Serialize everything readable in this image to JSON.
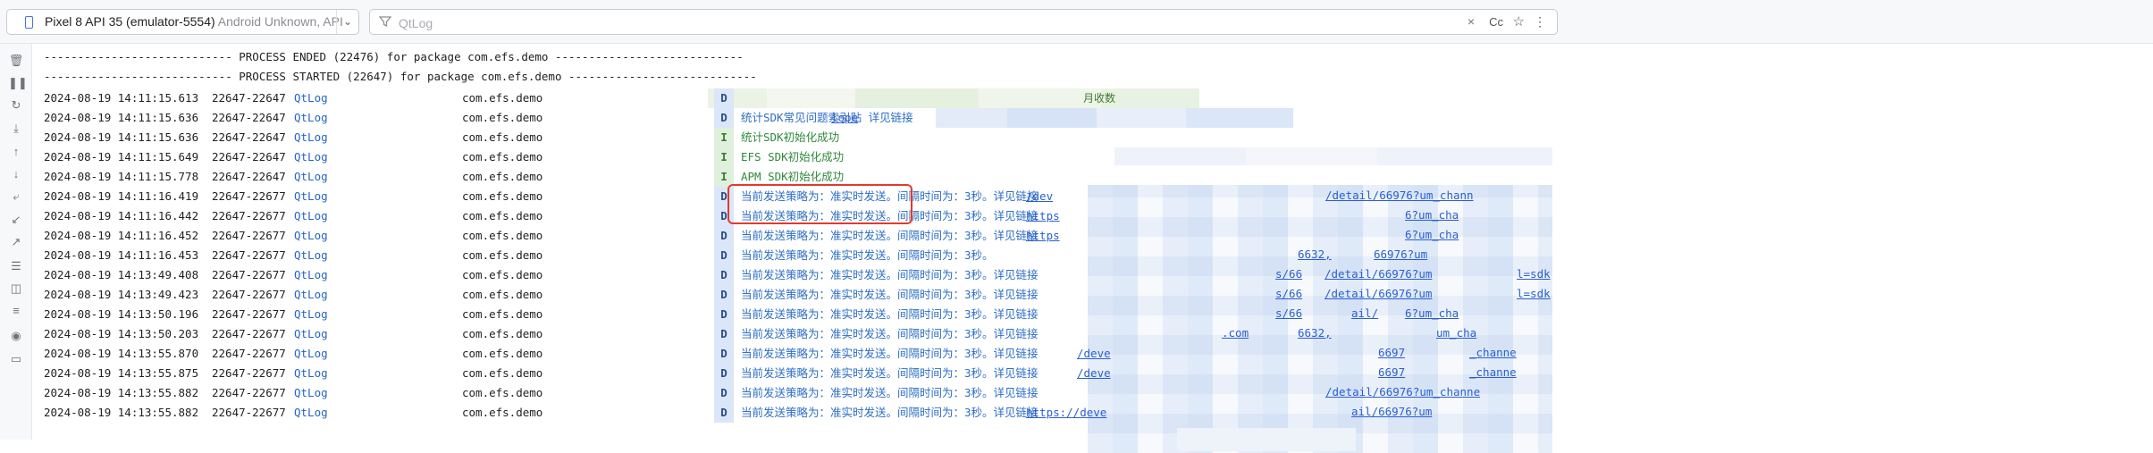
{
  "toolbar": {
    "device_name": "Pixel 8 API 35 (emulator-5554)",
    "device_os": "Android Unknown, API",
    "filter_placeholder": "QtLog",
    "filter_value": "",
    "cc_label": "Cc"
  },
  "log": {
    "process_ended": "---------------------------- PROCESS ENDED (22476) for package com.efs.demo ----------------------------",
    "process_started": "---------------------------- PROCESS STARTED (22647) for package com.efs.demo ----------------------------",
    "rows": [
      {
        "ts": "2024-08-19 14:11:15.613",
        "pid": "22647-22647",
        "tag": "QtLog",
        "pkg": "com.efs.demo",
        "lvl": "D",
        "msg": "",
        "link": ""
      },
      {
        "ts": "2024-08-19 14:11:15.636",
        "pid": "22647-22647",
        "tag": "QtLog",
        "pkg": "com.efs.demo",
        "lvl": "D",
        "msg": "统计SDK常见问题索引贴 详见链接",
        "link": "lope"
      },
      {
        "ts": "2024-08-19 14:11:15.636",
        "pid": "22647-22647",
        "tag": "QtLog",
        "pkg": "com.efs.demo",
        "lvl": "I",
        "msg": "统计SDK初始化成功",
        "link": ""
      },
      {
        "ts": "2024-08-19 14:11:15.649",
        "pid": "22647-22647",
        "tag": "QtLog",
        "pkg": "com.efs.demo",
        "lvl": "I",
        "msg": "EFS SDK初始化成功",
        "link": ""
      },
      {
        "ts": "2024-08-19 14:11:15.778",
        "pid": "22647-22647",
        "tag": "QtLog",
        "pkg": "com.efs.demo",
        "lvl": "I",
        "msg": "APM SDK初始化成功",
        "link": ""
      },
      {
        "ts": "2024-08-19 14:11:16.419",
        "pid": "22647-22677",
        "tag": "QtLog",
        "pkg": "com.efs.demo",
        "lvl": "D",
        "msg": "当前发送策略为：准实时发送。间隔时间为：3秒。详见链接",
        "link": "/dev"
      },
      {
        "ts": "2024-08-19 14:11:16.442",
        "pid": "22647-22677",
        "tag": "QtLog",
        "pkg": "com.efs.demo",
        "lvl": "D",
        "msg": "当前发送策略为：准实时发送。间隔时间为：3秒。详见链接",
        "link": "https"
      },
      {
        "ts": "2024-08-19 14:11:16.452",
        "pid": "22647-22677",
        "tag": "QtLog",
        "pkg": "com.efs.demo",
        "lvl": "D",
        "msg": "当前发送策略为：准实时发送。间隔时间为：3秒。详见链接",
        "link": "https"
      },
      {
        "ts": "2024-08-19 14:11:16.453",
        "pid": "22647-22677",
        "tag": "QtLog",
        "pkg": "com.efs.demo",
        "lvl": "D",
        "msg": "当前发送策略为：准实时发送。间隔时间为：3秒。",
        "link": ""
      },
      {
        "ts": "2024-08-19 14:13:49.408",
        "pid": "22647-22677",
        "tag": "QtLog",
        "pkg": "com.efs.demo",
        "lvl": "D",
        "msg": "当前发送策略为：准实时发送。间隔时间为：3秒。详见链接",
        "link": ""
      },
      {
        "ts": "2024-08-19 14:13:49.423",
        "pid": "22647-22677",
        "tag": "QtLog",
        "pkg": "com.efs.demo",
        "lvl": "D",
        "msg": "当前发送策略为：准实时发送。间隔时间为：3秒。详见链接",
        "link": ""
      },
      {
        "ts": "2024-08-19 14:13:50.196",
        "pid": "22647-22677",
        "tag": "QtLog",
        "pkg": "com.efs.demo",
        "lvl": "D",
        "msg": "当前发送策略为：准实时发送。间隔时间为：3秒。详见链接",
        "link": ""
      },
      {
        "ts": "2024-08-19 14:13:50.203",
        "pid": "22647-22677",
        "tag": "QtLog",
        "pkg": "com.efs.demo",
        "lvl": "D",
        "msg": "当前发送策略为：准实时发送。间隔时间为：3秒。详见链接",
        "link": ""
      },
      {
        "ts": "2024-08-19 14:13:55.870",
        "pid": "22647-22677",
        "tag": "QtLog",
        "pkg": "com.efs.demo",
        "lvl": "D",
        "msg": "当前发送策略为：准实时发送。间隔时间为：3秒。详见链接",
        "link": "/deve"
      },
      {
        "ts": "2024-08-19 14:13:55.875",
        "pid": "22647-22677",
        "tag": "QtLog",
        "pkg": "com.efs.demo",
        "lvl": "D",
        "msg": "当前发送策略为：准实时发送。间隔时间为：3秒。详见链接",
        "link": "/deve"
      },
      {
        "ts": "2024-08-19 14:13:55.882",
        "pid": "22647-22677",
        "tag": "QtLog",
        "pkg": "com.efs.demo",
        "lvl": "D",
        "msg": "当前发送策略为：准实时发送。间隔时间为：3秒。详见链接",
        "link": ""
      },
      {
        "ts": "2024-08-19 14:13:55.882",
        "pid": "22647-22677",
        "tag": "QtLog",
        "pkg": "com.efs.demo",
        "lvl": "D",
        "msg": "当前发送策略为：准实时发送。间隔时间为：3秒。详见链接",
        "link": "https://deve"
      }
    ],
    "fragments": {
      "revenue": "月收数",
      "r6a": "/detail/66976?um_chann",
      "r6b": "6?um_cha",
      "r7": "6?um_cha",
      "r8": "6632,",
      "r8b": "66976?um",
      "r9": "s/66",
      "r9b": "/detail/66976?um",
      "r9c": "l=sdk",
      "r10": "s/66",
      "r10b": "/detail/66976?um",
      "r10c": "l=sdk",
      "r11": "s/66",
      "r11b": "ail/",
      "r11c": "6?um_cha",
      "r12": ".com",
      "r12b": "6632,",
      "r12c": "um_cha",
      "r13": "6697",
      "r13b": "_channe",
      "r14": "6697",
      "r14b": "_channe",
      "r15": "/detail/66976?um_channe",
      "r16": "ail/66976?um"
    }
  },
  "colors": {
    "tag": "#2764c4",
    "debug_badge": "#dbe6f8",
    "info_badge": "#dff0dc",
    "info_text": "#2f8a3a",
    "highlight_box": "#e23a2d"
  }
}
